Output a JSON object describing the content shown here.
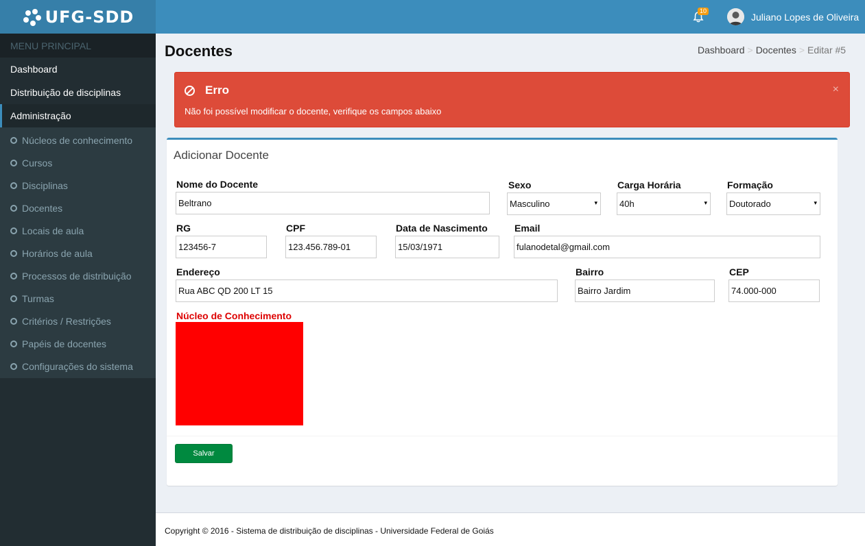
{
  "app": {
    "logo_text": "UFG-SDD"
  },
  "header": {
    "notification_count": "10",
    "username": "Juliano Lopes de Oliveira"
  },
  "sidebar": {
    "menu_header": "MENU PRINCIPAL",
    "items": [
      {
        "label": "Dashboard"
      },
      {
        "label": "Distribuição de disciplinas"
      },
      {
        "label": "Administração"
      }
    ],
    "subitems": [
      {
        "label": "Núcleos de conhecimento"
      },
      {
        "label": "Cursos"
      },
      {
        "label": "Disciplinas"
      },
      {
        "label": "Docentes"
      },
      {
        "label": "Locais de aula"
      },
      {
        "label": "Horários de aula"
      },
      {
        "label": "Processos de distribuição"
      },
      {
        "label": "Turmas"
      },
      {
        "label": "Critérios / Restrições"
      },
      {
        "label": "Papéis de docentes"
      },
      {
        "label": "Configurações do sistema"
      }
    ]
  },
  "page": {
    "title": "Docentes",
    "breadcrumb": [
      "Dashboard",
      "Docentes",
      "Editar #5"
    ]
  },
  "alert": {
    "title": "Erro",
    "message": "Não foi possível modificar o docente, verifique os campos abaixo",
    "close": "×"
  },
  "form": {
    "title": "Adicionar Docente",
    "nome": {
      "label": "Nome do Docente",
      "value": "Beltrano"
    },
    "sexo": {
      "label": "Sexo",
      "value": "Masculino"
    },
    "carga": {
      "label": "Carga Horária",
      "value": "40h"
    },
    "formacao": {
      "label": "Formação",
      "value": "Doutorado"
    },
    "rg": {
      "label": "RG",
      "value": "123456-7"
    },
    "cpf": {
      "label": "CPF",
      "value": "123.456.789-01"
    },
    "nascimento": {
      "label": "Data de Nascimento",
      "value": "15/03/1971"
    },
    "email": {
      "label": "Email",
      "value": "fulanodetal@gmail.com"
    },
    "endereco": {
      "label": "Endereço",
      "value": "Rua ABC QD 200 LT 15"
    },
    "bairro": {
      "label": "Bairro",
      "value": "Bairro Jardim"
    },
    "cep": {
      "label": "CEP",
      "value": "74.000-000"
    },
    "nucleo": {
      "label": "Núcleo de Conhecimento"
    },
    "save_label": "Salvar"
  },
  "footer": {
    "text": "Copyright © 2016 - Sistema de distribuição de disciplinas - Universidade Federal de Goiás"
  },
  "colors": {
    "primary": "#3c8dbc",
    "sidebar": "#222d32",
    "danger": "#dd4b39",
    "success": "#00893f",
    "error_field": "#ff0000"
  }
}
